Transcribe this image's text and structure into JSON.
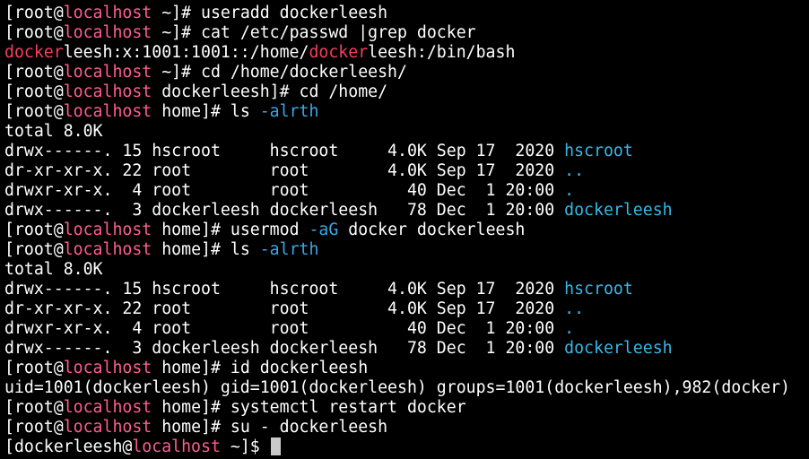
{
  "colors": {
    "background": "#000000",
    "foreground": "#ffffff",
    "hostname": "#ff5c93",
    "grep_match": "#f53f5d",
    "option_flag": "#3aa7e6",
    "directory": "#36b8e6",
    "cursor": "#c9c9c9"
  },
  "lines": [
    {
      "name": "prompt-line",
      "segments": [
        {
          "t": "[root@",
          "c": "default"
        },
        {
          "t": "localhost",
          "c": "host"
        },
        {
          "t": " ~]# useradd dockerleesh",
          "c": "default"
        }
      ]
    },
    {
      "name": "prompt-line",
      "segments": [
        {
          "t": "[root@",
          "c": "default"
        },
        {
          "t": "localhost",
          "c": "host"
        },
        {
          "t": " ~]# cat /etc/passwd |grep docker",
          "c": "default"
        }
      ]
    },
    {
      "name": "output-line",
      "segments": [
        {
          "t": "docker",
          "c": "red"
        },
        {
          "t": "leesh:x:1001:1001::/home/",
          "c": "default"
        },
        {
          "t": "docker",
          "c": "red"
        },
        {
          "t": "leesh:/bin/bash",
          "c": "default"
        }
      ]
    },
    {
      "name": "prompt-line",
      "segments": [
        {
          "t": "[root@",
          "c": "default"
        },
        {
          "t": "localhost",
          "c": "host"
        },
        {
          "t": " ~]# cd /home/dockerleesh/",
          "c": "default"
        }
      ]
    },
    {
      "name": "prompt-line",
      "segments": [
        {
          "t": "[root@",
          "c": "default"
        },
        {
          "t": "localhost",
          "c": "host"
        },
        {
          "t": " dockerleesh]# cd /home/",
          "c": "default"
        }
      ]
    },
    {
      "name": "prompt-line",
      "segments": [
        {
          "t": "[root@",
          "c": "default"
        },
        {
          "t": "localhost",
          "c": "host"
        },
        {
          "t": " home]# ls ",
          "c": "default"
        },
        {
          "t": "-alrth",
          "c": "flag"
        }
      ]
    },
    {
      "name": "output-line",
      "segments": [
        {
          "t": "total 8.0K",
          "c": "default"
        }
      ]
    },
    {
      "name": "listing-row",
      "segments": [
        {
          "t": "drwx------. 15 hscroot     hscroot     4.0K Sep 17  2020 ",
          "c": "default"
        },
        {
          "t": "hscroot",
          "c": "dir"
        }
      ]
    },
    {
      "name": "listing-row",
      "segments": [
        {
          "t": "dr-xr-xr-x. 22 root        root        4.0K Sep 17  2020 ",
          "c": "default"
        },
        {
          "t": "..",
          "c": "dir"
        }
      ]
    },
    {
      "name": "listing-row",
      "segments": [
        {
          "t": "drwxr-xr-x.  4 root        root          40 Dec  1 20:00 ",
          "c": "default"
        },
        {
          "t": ".",
          "c": "dir"
        }
      ]
    },
    {
      "name": "listing-row",
      "segments": [
        {
          "t": "drwx------.  3 dockerleesh dockerleesh   78 Dec  1 20:00 ",
          "c": "default"
        },
        {
          "t": "dockerleesh",
          "c": "dir"
        }
      ]
    },
    {
      "name": "prompt-line",
      "segments": [
        {
          "t": "[root@",
          "c": "default"
        },
        {
          "t": "localhost",
          "c": "host"
        },
        {
          "t": " home]# usermod ",
          "c": "default"
        },
        {
          "t": "-aG",
          "c": "flag"
        },
        {
          "t": " docker dockerleesh",
          "c": "default"
        }
      ]
    },
    {
      "name": "prompt-line",
      "segments": [
        {
          "t": "[root@",
          "c": "default"
        },
        {
          "t": "localhost",
          "c": "host"
        },
        {
          "t": " home]# ls ",
          "c": "default"
        },
        {
          "t": "-alrth",
          "c": "flag"
        }
      ]
    },
    {
      "name": "output-line",
      "segments": [
        {
          "t": "total 8.0K",
          "c": "default"
        }
      ]
    },
    {
      "name": "listing-row",
      "segments": [
        {
          "t": "drwx------. 15 hscroot     hscroot     4.0K Sep 17  2020 ",
          "c": "default"
        },
        {
          "t": "hscroot",
          "c": "dir"
        }
      ]
    },
    {
      "name": "listing-row",
      "segments": [
        {
          "t": "dr-xr-xr-x. 22 root        root        4.0K Sep 17  2020 ",
          "c": "default"
        },
        {
          "t": "..",
          "c": "dir"
        }
      ]
    },
    {
      "name": "listing-row",
      "segments": [
        {
          "t": "drwxr-xr-x.  4 root        root          40 Dec  1 20:00 ",
          "c": "default"
        },
        {
          "t": ".",
          "c": "dir"
        }
      ]
    },
    {
      "name": "listing-row",
      "segments": [
        {
          "t": "drwx------.  3 dockerleesh dockerleesh   78 Dec  1 20:00 ",
          "c": "default"
        },
        {
          "t": "dockerleesh",
          "c": "dir"
        }
      ]
    },
    {
      "name": "prompt-line",
      "segments": [
        {
          "t": "[root@",
          "c": "default"
        },
        {
          "t": "localhost",
          "c": "host"
        },
        {
          "t": " home]# id dockerleesh",
          "c": "default"
        }
      ]
    },
    {
      "name": "output-line",
      "segments": [
        {
          "t": "uid=1001(dockerleesh) gid=1001(dockerleesh) groups=1001(dockerleesh),982(docker)",
          "c": "default"
        }
      ]
    },
    {
      "name": "prompt-line",
      "segments": [
        {
          "t": "[root@",
          "c": "default"
        },
        {
          "t": "localhost",
          "c": "host"
        },
        {
          "t": " home]# systemctl restart docker",
          "c": "default"
        }
      ]
    },
    {
      "name": "prompt-line",
      "segments": [
        {
          "t": "[root@",
          "c": "default"
        },
        {
          "t": "localhost",
          "c": "host"
        },
        {
          "t": " home]# su - dockerleesh",
          "c": "default"
        }
      ]
    },
    {
      "name": "current-prompt-line",
      "cursor": true,
      "segments": [
        {
          "t": "[dockerleesh@",
          "c": "default"
        },
        {
          "t": "localhost",
          "c": "host"
        },
        {
          "t": " ~]$ ",
          "c": "default"
        }
      ]
    }
  ]
}
